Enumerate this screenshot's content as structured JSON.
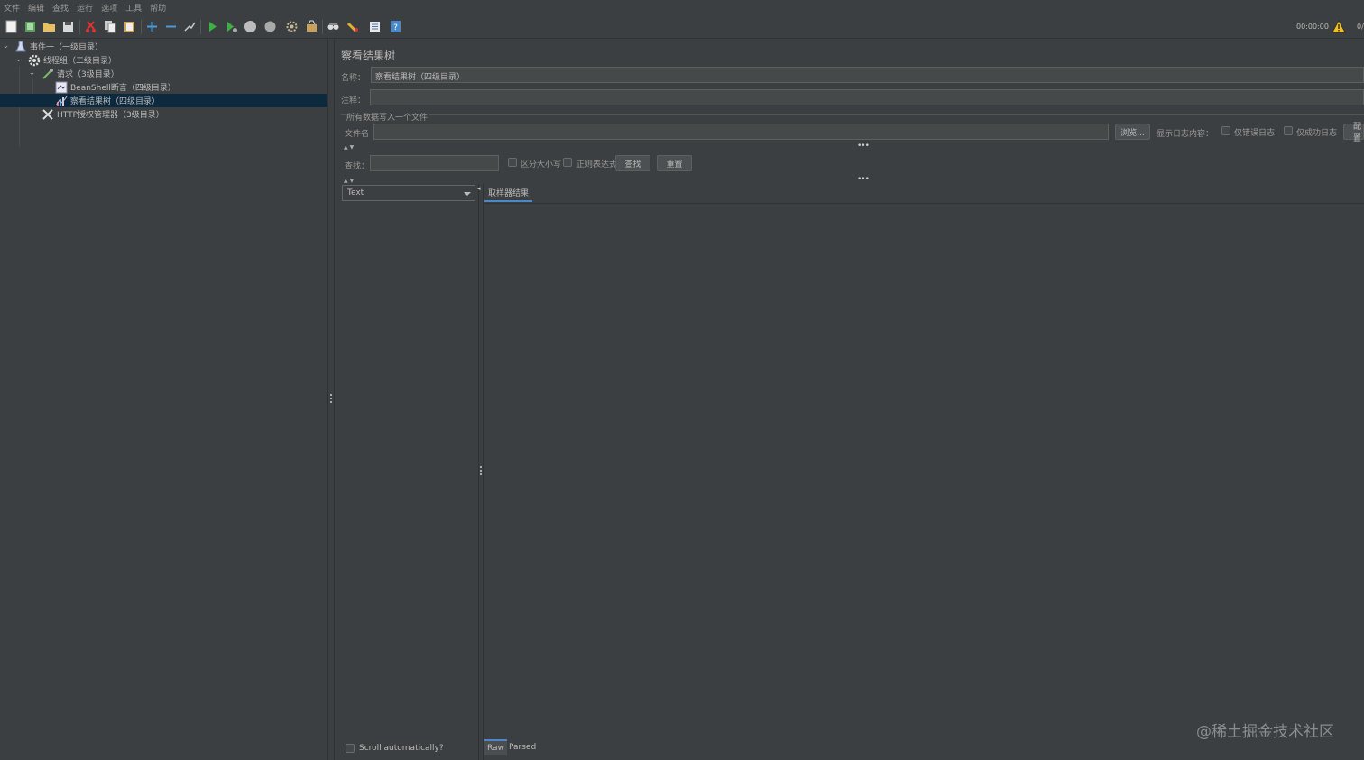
{
  "menu": [
    "文件",
    "编辑",
    "查找",
    "运行",
    "选项",
    "工具",
    "帮助"
  ],
  "toolbar": {
    "icons": [
      "new-icon",
      "templates-icon",
      "open-icon",
      "save-icon",
      "cut-icon",
      "copy-icon",
      "paste-icon",
      "expand-icon",
      "collapse-icon",
      "toggle-icon",
      "start-icon",
      "start-no-pause-icon",
      "stop-icon",
      "shutdown-icon",
      "clear-icon",
      "clear-all-icon",
      "search-icon",
      "reset-search-icon",
      "function-helper-icon",
      "help-icon"
    ],
    "timer": "00:00:00",
    "counter": "0/"
  },
  "tree": [
    {
      "label": "事件一（一级目录）",
      "expanded": true
    },
    {
      "label": "线程组（二级目录）",
      "expanded": true
    },
    {
      "label": "请求（3级目录）",
      "expanded": true
    },
    {
      "label": "BeanShell断言（四级目录）"
    },
    {
      "label": "察看结果树（四级目录）",
      "selected": true
    },
    {
      "label": "HTTP授权管理器（3级目录）"
    }
  ],
  "panel": {
    "title": "察看结果树",
    "name_label": "名称：",
    "name_value": "察看结果树（四级目录）",
    "comment_label": "注释：",
    "comment_value": "",
    "group_title": "所有数据写入一个文件",
    "filename_label": "文件名",
    "filename_value": "",
    "browse_button": "浏览...",
    "log_content_label": "显示日志内容：",
    "errors_only": "仅错误日志",
    "success_only": "仅成功日志",
    "configure_button": "配置",
    "search_label": "查找：",
    "search_value": "",
    "case_sensitive": "区分大小写",
    "regex": "正则表达式",
    "find_button": "查找",
    "reset_button": "重置",
    "renderer": "Text",
    "sampler_tab": "取样器结果",
    "scroll_auto": "Scroll automatically?",
    "raw_tab": "Raw",
    "parsed_tab": "Parsed"
  },
  "watermark": "@稀土掘金技术社区"
}
